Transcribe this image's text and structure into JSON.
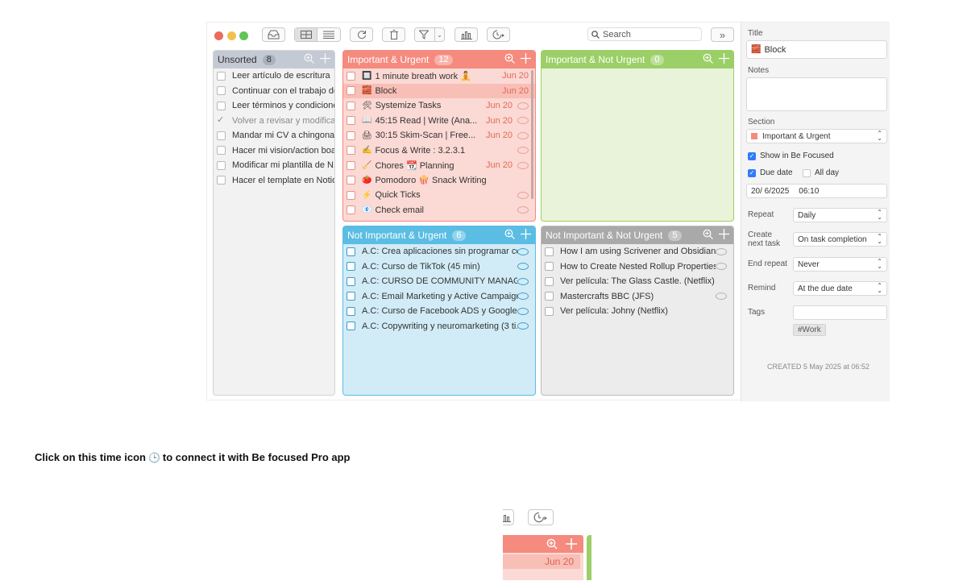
{
  "toolbar": {
    "search_placeholder": "Search",
    "expand_label": "»"
  },
  "columns": [
    {
      "title": "Unsorted",
      "count": "8",
      "items": [
        {
          "text": "Leer artículo de escritura"
        },
        {
          "text": "Continuar con el trabajo de..."
        },
        {
          "text": "Leer términos y condicione..."
        },
        {
          "text": "Volver a revisar y modificar...",
          "done": true
        },
        {
          "text": "Mandar mi CV a chingona..."
        },
        {
          "text": "Hacer mi vision/action boar..."
        },
        {
          "text": "Modificar mi plantilla de N..."
        },
        {
          "text": "Hacer el template en Notio..."
        }
      ]
    },
    {
      "title": "Important & Urgent",
      "count": "12",
      "items": [
        {
          "emoji": "🔲",
          "text": "1 minute breath work 🧘",
          "date": "Jun 20"
        },
        {
          "emoji": "🧱",
          "text": "Block",
          "date": "Jun 20",
          "selected": true
        },
        {
          "emoji": "🛠",
          "text": "Systemize Tasks",
          "date": "Jun 20",
          "comment": true
        },
        {
          "emoji": "📖",
          "text": "45:15 Read | Write (Ana...",
          "date": "Jun 20",
          "comment": true
        },
        {
          "emoji": "🖨",
          "text": "30:15 Skim-Scan | Free...",
          "date": "Jun 20",
          "comment": true
        },
        {
          "emoji": "✍️",
          "text": "Focus & Write : 3.2.3.1",
          "comment": true
        },
        {
          "emoji": "🧹",
          "text": "Chores 📆 Planning",
          "date": "Jun 20",
          "comment": true
        },
        {
          "emoji": "🍅",
          "text": "Pomodoro 🍿 Snack Writing"
        },
        {
          "emoji": "⚡",
          "text": "Quick Ticks",
          "comment": true
        },
        {
          "emoji": "📧",
          "text": "Check email",
          "comment": true
        }
      ]
    },
    {
      "title": "Important & Not Urgent",
      "count": "0",
      "items": []
    },
    {
      "title": "Not Important & Urgent",
      "count": "6",
      "items": [
        {
          "text": "A.C: Crea aplicaciones sin programar co...",
          "comment": true
        },
        {
          "text": "A.C: Curso de TikTok (45 min)",
          "comment": true
        },
        {
          "text": "A.C: CURSO DE COMMUNITY MANAGE...",
          "comment": true
        },
        {
          "text": "A.C: Email Marketing y Active Campaign...",
          "comment": true
        },
        {
          "text": "A.C: Curso de Facebook ADS y Google...",
          "comment": true
        },
        {
          "text": "A.C: Copywriting y neuromarketing (3 ti...",
          "comment": true
        }
      ]
    },
    {
      "title": "Not Important & Not Urgent",
      "count": "5",
      "items": [
        {
          "text": "How I am using Scrivener and Obsidian...",
          "comment": true
        },
        {
          "text": "How to Create Nested Rollup Properties...",
          "comment": true
        },
        {
          "text": "Ver película: The Glass Castle. (Netflix)"
        },
        {
          "text": "Mastercrafts BBC (JFS)",
          "comment": true
        },
        {
          "text": "Ver película: Johny (Netflix)"
        }
      ]
    }
  ],
  "inspector": {
    "title_label": "Title",
    "title_value": "Block",
    "title_emoji": "🧱",
    "notes_label": "Notes",
    "section_label": "Section",
    "section_value": "Important & Urgent",
    "show_focused": "Show in Be Focused",
    "due_date_label": "Due date",
    "all_day_label": "All day",
    "date_value": "20/  6/2025",
    "time_value": "06:10",
    "repeat_label": "Repeat",
    "repeat_value": "Daily",
    "create_next_label_1": "Create",
    "create_next_label_2": "next task",
    "create_next_value": "On task completion",
    "end_repeat_label": "End repeat",
    "end_repeat_value": "Never",
    "remind_label": "Remind",
    "remind_value": "At the due date",
    "tags_label": "Tags",
    "tag": "#Work",
    "created": "CREATED 5 May 2025 at 06:52"
  },
  "caption": {
    "before": "Click on this time icon",
    "icon": "🕒",
    "after": "to connect it with Be focused Pro app"
  },
  "zoom": {
    "date": "Jun 20"
  },
  "colors": {
    "red": "#f58a7e",
    "green": "#9bcf67",
    "blue": "#5bbde3",
    "gray": "#a9a9a9",
    "unsorted": "#c4cad3"
  }
}
